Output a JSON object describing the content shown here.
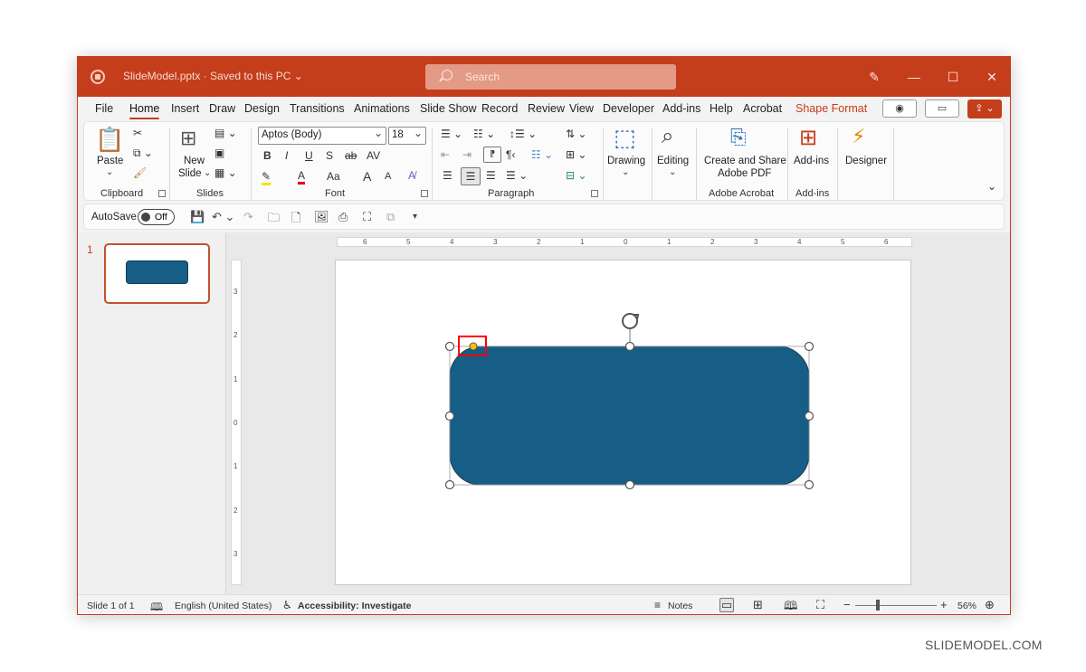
{
  "window": {
    "doc_title": "SlideModel.pptx · Saved to this PC ⌄",
    "search_placeholder": "Search"
  },
  "tabs": [
    "File",
    "Home",
    "Insert",
    "Draw",
    "Design",
    "Transitions",
    "Animations",
    "Slide Show",
    "Record",
    "Review",
    "View",
    "Developer",
    "Add-ins",
    "Help",
    "Acrobat",
    "Shape Format"
  ],
  "active_tab": "Home",
  "ribbon": {
    "clipboard": {
      "paste": "Paste",
      "label": "Clipboard"
    },
    "slides": {
      "new_slide_line1": "New",
      "new_slide_line2": "Slide",
      "label": "Slides"
    },
    "font": {
      "font_name": "Aptos (Body)",
      "font_size": "18",
      "bold": "B",
      "italic": "I",
      "underline": "U",
      "strike": "S",
      "abc": "ab",
      "spacing": "AV",
      "case": "Aa",
      "grow": "A",
      "shrink": "A",
      "label": "Font"
    },
    "paragraph": {
      "label": "Paragraph"
    },
    "drawing": {
      "label": "Drawing"
    },
    "editing": {
      "label": "Editing"
    },
    "adobe": {
      "line1": "Create and Share",
      "line2": "Adobe PDF",
      "label": "Adobe Acrobat"
    },
    "addins": {
      "button": "Add-ins",
      "label": "Add-ins"
    },
    "designer": {
      "button": "Designer"
    }
  },
  "qat": {
    "autosave": "AutoSave",
    "toggle_state": "Off"
  },
  "slides_panel": {
    "slide_number": "1"
  },
  "rulers": {
    "horizontal": [
      "6",
      "5",
      "4",
      "3",
      "2",
      "1",
      "0",
      "1",
      "2",
      "3",
      "4",
      "5",
      "6"
    ],
    "vertical": [
      "3",
      "2",
      "1",
      "0",
      "1",
      "2",
      "3"
    ]
  },
  "status": {
    "slide_of": "Slide 1 of 1",
    "language": "English (United States)",
    "accessibility": "Accessibility: Investigate",
    "notes": "Notes",
    "zoom": "56%"
  },
  "colors": {
    "accent": "#c43e1c",
    "shape_fill": "#165e85",
    "handle_highlight": "#ff0000",
    "adjust_handle": "#f5c400"
  },
  "watermark": "SLIDEMODEL.COM"
}
